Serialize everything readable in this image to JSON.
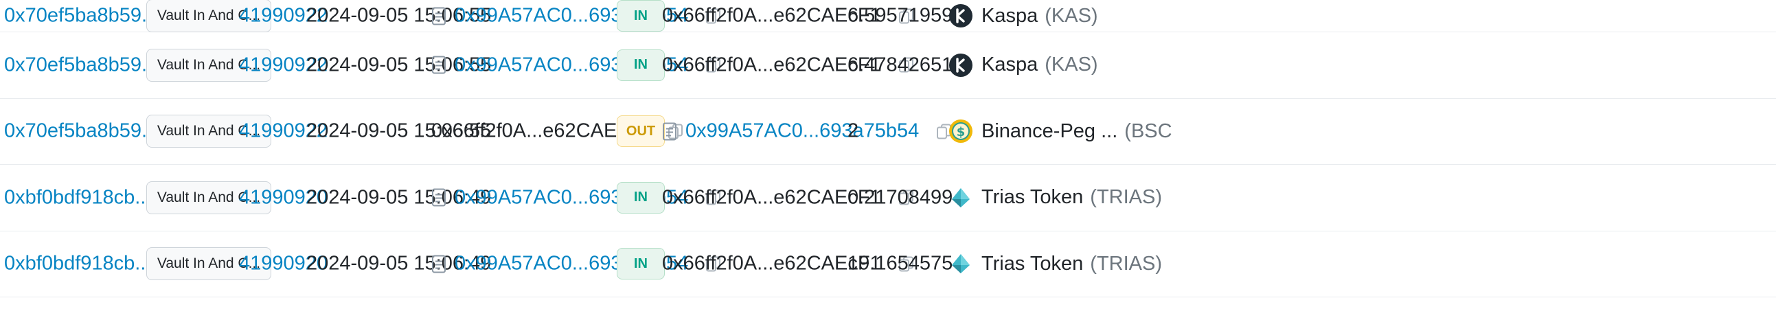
{
  "rows": [
    {
      "tx_hash": "0x70ef5ba8b59...",
      "method": "Vault In And C...",
      "block": "41990922",
      "age": "2024-09-05 15:06:55",
      "from": "0x99A57AC0...693a75b54",
      "from_is_contract": true,
      "from_is_link": true,
      "direction": "IN",
      "to": "0x66ff2f0A...e62CAEcF1",
      "to_is_contract": false,
      "to_is_link": false,
      "amount": "6.59571959",
      "token_name": "Kaspa",
      "token_symbol": "(KAS)",
      "token_icon": "kaspa-icon"
    },
    {
      "tx_hash": "0x70ef5ba8b59...",
      "method": "Vault In And C...",
      "block": "41990922",
      "age": "2024-09-05 15:06:55",
      "from": "0x99A57AC0...693a75b54",
      "from_is_contract": true,
      "from_is_link": true,
      "direction": "IN",
      "to": "0x66ff2f0A...e62CAEcF1",
      "to_is_contract": false,
      "to_is_link": false,
      "amount": "6.47842651",
      "token_name": "Kaspa",
      "token_symbol": "(KAS)",
      "token_icon": "kaspa-icon"
    },
    {
      "tx_hash": "0x70ef5ba8b59...",
      "method": "Vault In And C...",
      "block": "41990922",
      "age": "2024-09-05 15:06:55",
      "from": "0x66ff2f0A...e62CAEcF1",
      "from_is_contract": false,
      "from_is_link": false,
      "direction": "OUT",
      "to": "0x99A57AC0...693a75b54",
      "to_is_contract": true,
      "to_is_link": true,
      "amount": "2",
      "token_name": "Binance-Peg ...",
      "token_symbol": "(BSC",
      "token_icon": "binance-peg-usd-icon"
    },
    {
      "tx_hash": "0xbf0bdf918cb...",
      "method": "Vault In And C...",
      "block": "41990920",
      "age": "2024-09-05 15:06:49",
      "from": "0x99A57AC0...693a75b54",
      "from_is_contract": true,
      "from_is_link": true,
      "direction": "IN",
      "to": "0x66ff2f0A...e62CAEcF1",
      "to_is_contract": false,
      "to_is_link": false,
      "amount": "0.21708499",
      "token_name": "Trias Token",
      "token_symbol": "(TRIAS)",
      "token_icon": "trias-icon"
    },
    {
      "tx_hash": "0xbf0bdf918cb...",
      "method": "Vault In And C...",
      "block": "41990920",
      "age": "2024-09-05 15:06:49",
      "from": "0x99A57AC0...693a75b54",
      "from_is_contract": true,
      "from_is_link": true,
      "direction": "IN",
      "to": "0x66ff2f0A...e62CAEcF1",
      "to_is_contract": false,
      "to_is_link": false,
      "amount": "19.1654575",
      "token_name": "Trias Token",
      "token_symbol": "(TRIAS)",
      "token_icon": "trias-icon"
    }
  ],
  "colors": {
    "link": "#0784c3",
    "in_text": "#00a186",
    "in_bg": "#e8f5ee",
    "out_text": "#cc9a06",
    "out_bg": "#fff8e6",
    "border": "#e9ecef"
  }
}
